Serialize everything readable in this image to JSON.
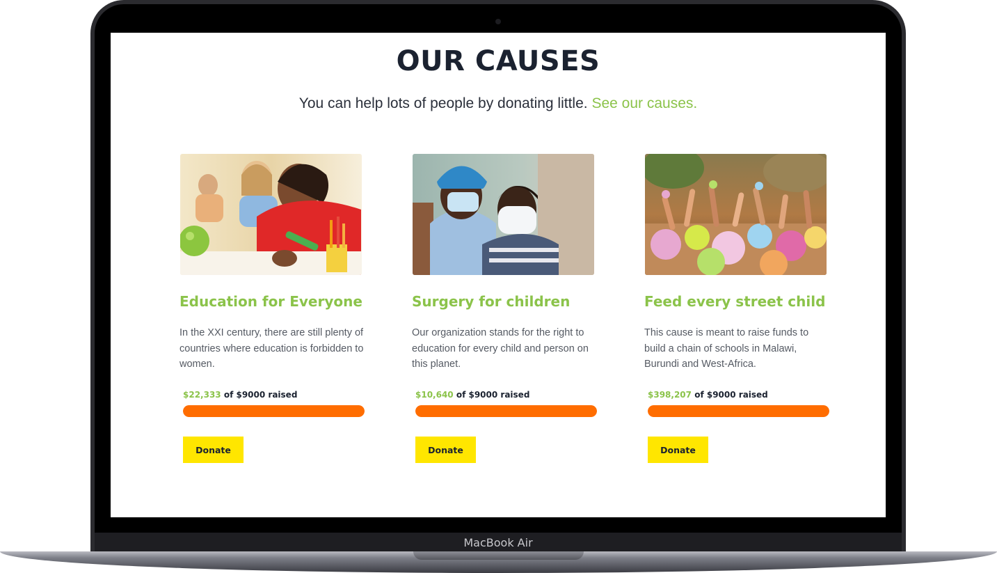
{
  "device": {
    "label": "MacBook Air"
  },
  "header": {
    "title": "OUR CAUSES",
    "subtitle_text": "You can help lots of people by donating little.",
    "subtitle_link": "See our causes."
  },
  "colors": {
    "accent": "#8bc34a",
    "progress": "#ff6d00",
    "button": "#ffe600",
    "heading": "#1b2230"
  },
  "causes": [
    {
      "title": "Education for Everyone",
      "description": "In the XXI century, there are still plenty of countries where education is forbidden to women.",
      "raised_amount": "$22,333",
      "raised_suffix": "of $9000 raised",
      "progress": 1.0,
      "donate_label": "Donate"
    },
    {
      "title": "Surgery for children",
      "description": "Our organization stands for the right to education for every child and person on this planet.",
      "raised_amount": "$10,640",
      "raised_suffix": "of $9000 raised",
      "progress": 1.0,
      "donate_label": "Donate"
    },
    {
      "title": "Feed every street child",
      "description": "This cause is meant to raise funds to build a chain of schools in Malawi, Burundi and West-Africa.",
      "raised_amount": "$398,207",
      "raised_suffix": "of $9000 raised",
      "progress": 1.0,
      "donate_label": "Donate"
    }
  ]
}
